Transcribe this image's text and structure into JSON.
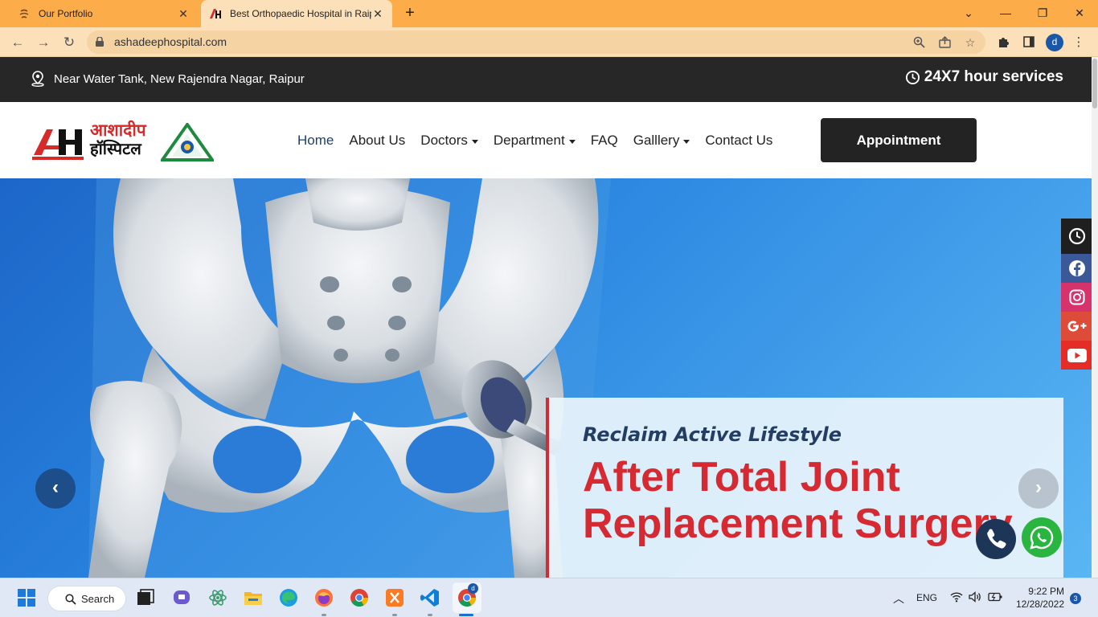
{
  "browser": {
    "tabs": [
      {
        "title": "Our Portfolio",
        "active": false
      },
      {
        "title": "Best Orthopaedic Hospital in Raip",
        "active": true
      }
    ],
    "new_tab_symbol": "+",
    "window_controls": {
      "dropdown": "⌄",
      "minimize": "—",
      "restore": "❐",
      "close": "✕"
    },
    "url": "ashadeephospital.com",
    "profile_initial": "d"
  },
  "topbar": {
    "address": "Near Water Tank, New Rajendra Nagar, Raipur",
    "services": "24X7 hour services"
  },
  "header": {
    "logo_hindi_line1": "आशादीप",
    "logo_hindi_line2": "हॉस्पिटल",
    "menu": [
      {
        "label": "Home",
        "active": true,
        "dropdown": false
      },
      {
        "label": "About Us",
        "active": false,
        "dropdown": false
      },
      {
        "label": "Doctors",
        "active": false,
        "dropdown": true
      },
      {
        "label": "Department",
        "active": false,
        "dropdown": true
      },
      {
        "label": "FAQ",
        "active": false,
        "dropdown": false
      },
      {
        "label": "Galllery",
        "active": false,
        "dropdown": true
      },
      {
        "label": "Contact Us",
        "active": false,
        "dropdown": false
      }
    ],
    "appointment_label": "Appointment"
  },
  "hero": {
    "subtitle": "Reclaim Active Lifestyle",
    "heading_line1": "After Total Joint",
    "heading_line2": "Replacement Surgery",
    "prev_symbol": "‹",
    "next_symbol": "›"
  },
  "social_icons": [
    "clock-icon",
    "facebook-icon",
    "instagram-icon",
    "google-plus-icon",
    "youtube-icon"
  ],
  "colors": {
    "tab_bar": "#fcad4a",
    "topbar": "#272727",
    "accent_red": "#d62a33",
    "navy": "#1d3f6e",
    "whatsapp": "#2ab540"
  },
  "taskbar": {
    "search_label": "Search",
    "language": "ENG",
    "time": "9:22 PM",
    "date": "12/28/2022",
    "notification_count": "3",
    "chrome_badge": "d"
  }
}
